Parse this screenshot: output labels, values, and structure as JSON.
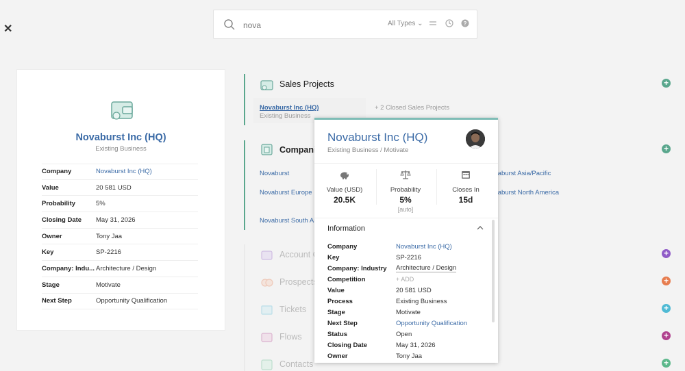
{
  "search": {
    "value": "nova",
    "types_label": "All Types",
    "types_caret": "⌄"
  },
  "left_card": {
    "title": "Novaburst Inc (HQ)",
    "subtitle": "Existing Business",
    "fields": [
      {
        "label": "Company",
        "value": "Novaburst Inc (HQ)"
      },
      {
        "label": "Value",
        "value": "20 581 USD"
      },
      {
        "label": "Probability",
        "value": "5%"
      },
      {
        "label": "Closing Date",
        "value": "May 31, 2026"
      },
      {
        "label": "Owner",
        "value": "Tony Jaa"
      },
      {
        "label": "Key",
        "value": "SP-2216"
      },
      {
        "label": "Company: Indu...",
        "value": "Architecture / Design"
      },
      {
        "label": "Stage",
        "value": "Motivate"
      },
      {
        "label": "Next Step",
        "value": "Opportunity Qualification"
      }
    ]
  },
  "sections": {
    "sales_projects": "Sales Projects",
    "companies": "Companies",
    "account": "Account C",
    "prospects": "Prospects",
    "tickets": "Tickets",
    "flows": "Flows",
    "contacts": "Contacts"
  },
  "sales_project": {
    "link": "Novaburst Inc (HQ)",
    "sub": "Existing Business",
    "closed": "+ 2 Closed Sales Projects"
  },
  "companies_links": {
    "c1": "Novaburst",
    "c2": "Novaburst Europe",
    "c3": "Novaburst South Am",
    "c4": "vaburst Asia/Pacific",
    "c5": "vaburst North America"
  },
  "popup": {
    "title": "Novaburst Inc (HQ)",
    "subtitle": "Existing Business  /  Motivate",
    "stats": [
      {
        "label": "Value (USD)",
        "value": "20.5K",
        "extra": ""
      },
      {
        "label": "Probability",
        "value": "5%",
        "extra": "[auto]"
      },
      {
        "label": "Closes In",
        "value": "15d",
        "extra": ""
      }
    ],
    "info_title": "Information",
    "rows": [
      {
        "label": "Company",
        "value": "Novaburst Inc (HQ)"
      },
      {
        "label": "Key",
        "value": "SP-2216"
      },
      {
        "label": "Company: Industry",
        "value": "Architecture / Design"
      },
      {
        "label": "Competition",
        "value": "+ ADD"
      },
      {
        "label": "Value",
        "value": "20 581 USD"
      },
      {
        "label": "Process",
        "value": "Existing Business"
      },
      {
        "label": "Stage",
        "value": "Motivate"
      },
      {
        "label": "Next Step",
        "value": "Opportunity Qualification"
      },
      {
        "label": "Status",
        "value": "Open"
      },
      {
        "label": "Closing Date",
        "value": "May 31, 2026"
      },
      {
        "label": "Owner",
        "value": "Tony Jaa"
      }
    ]
  },
  "colors": {
    "accent": "#3a6aa6",
    "teal": "#5aa78d",
    "purple": "#8f5bc7",
    "orange": "#e77d4f",
    "cyan": "#4fbad4",
    "magenta": "#b0418e",
    "green": "#5cb88b"
  },
  "icons": [
    "close-icon",
    "search-icon",
    "equals-icon",
    "history-icon",
    "help-icon",
    "wallet-icon",
    "piggy-bank-icon",
    "scale-icon",
    "calendar-icon",
    "chevron-up-icon",
    "plus-icon"
  ]
}
